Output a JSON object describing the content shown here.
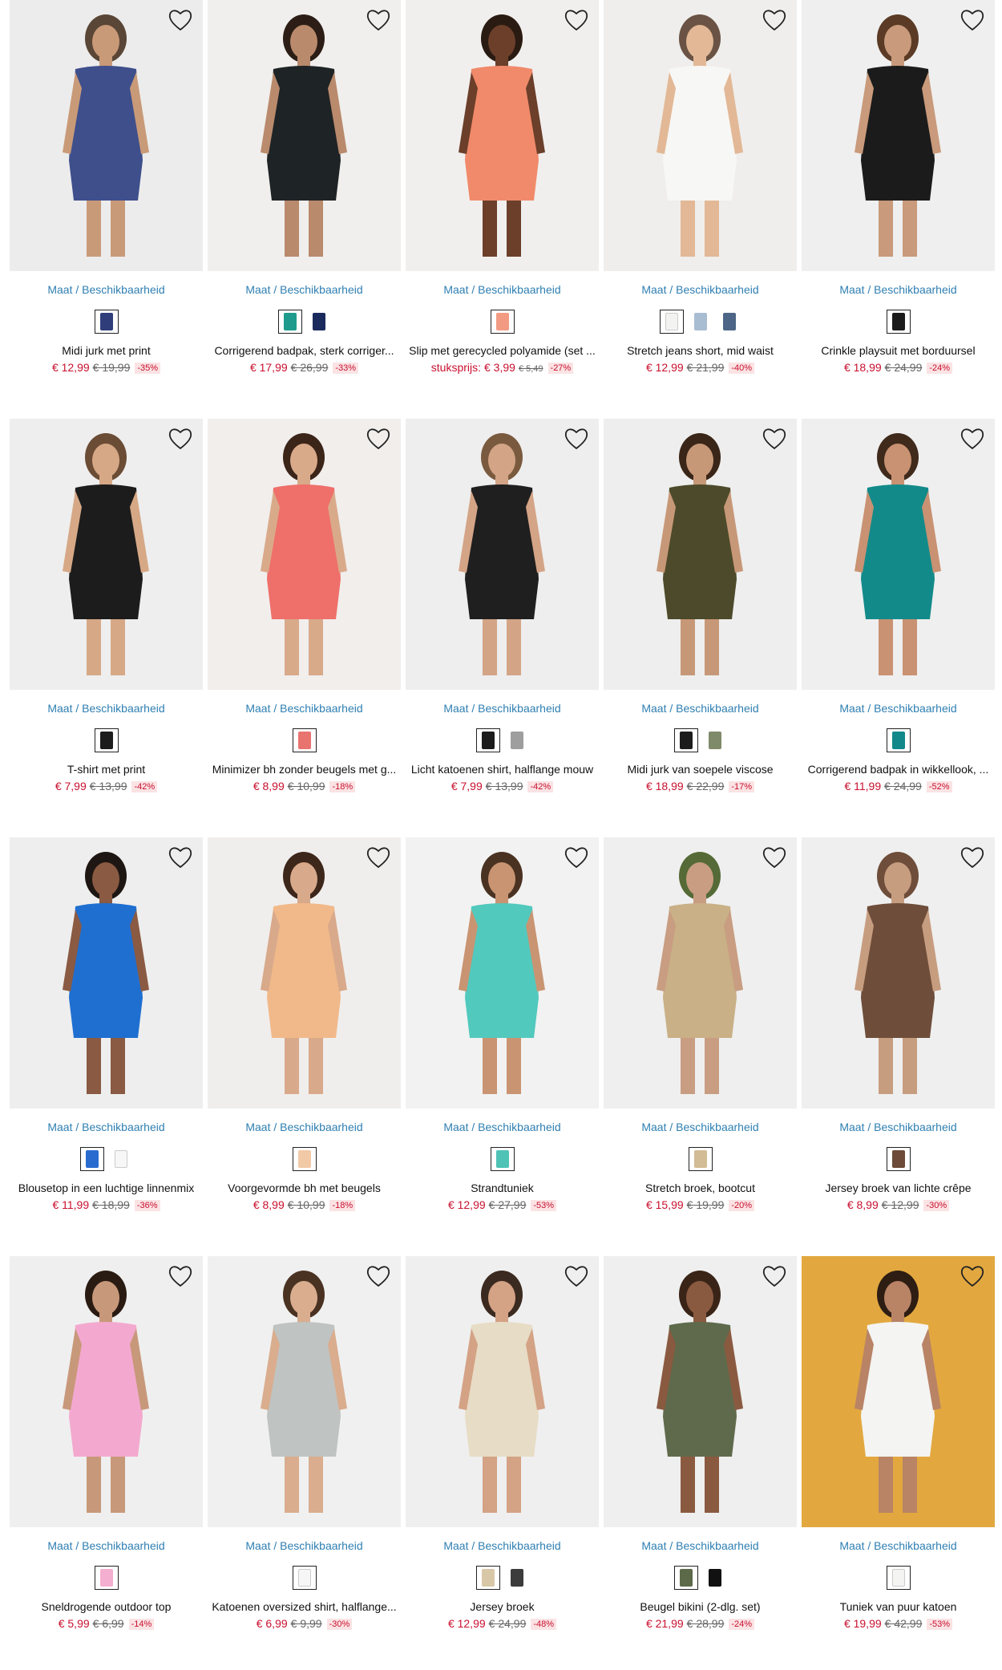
{
  "size_link_label": "Maat / Beschikbaarheid",
  "colors": {
    "accent_link": "#2f7fb2",
    "price_red": "#c8102e",
    "discount_bg": "#fbe3e4"
  },
  "products": [
    {
      "title": "Midi jurk met print",
      "price": "€ 12,99",
      "old": "€ 19,99",
      "discount": "-35%",
      "bg": "#ececec",
      "garment": "#3e4f8c",
      "skin": "#c99a78",
      "hair": "#5a4636",
      "swatches": [
        "#2f3e7a"
      ]
    },
    {
      "title": "Corrigerend badpak, sterk corriger...",
      "price": "€ 17,99",
      "old": "€ 26,99",
      "discount": "-33%",
      "bg": "#f0efed",
      "garment": "#1e2326",
      "skin": "#b98a6c",
      "hair": "#2c1e16",
      "swatches": [
        "#1e9b8c",
        "#1b2a5c"
      ]
    },
    {
      "title": "Slip met gerecycled polyamide (set ...",
      "price_prefix": "stuksprijs:",
      "price": "€ 3,99",
      "old": "€ 5,49",
      "old_small": true,
      "discount": "-27%",
      "bg": "#f1efee",
      "garment": "#f08a6a",
      "skin": "#6b3f2a",
      "hair": "#2a1b12",
      "swatches": [
        "#f29b82"
      ]
    },
    {
      "title": "Stretch jeans short, mid waist",
      "price": "€ 12,99",
      "old": "€ 21,99",
      "discount": "-40%",
      "bg": "#efeeec",
      "garment": "#f7f7f5",
      "skin": "#e2b896",
      "hair": "#6a5344",
      "swatches": [
        "#f3f3f1",
        "#a9bdd2",
        "#4d6687"
      ]
    },
    {
      "title": "Crinkle playsuit met borduursel",
      "price": "€ 18,99",
      "old": "€ 24,99",
      "discount": "-24%",
      "bg": "#efefef",
      "garment": "#1b1b1b",
      "skin": "#c99a7b",
      "hair": "#5b3b26",
      "swatches": [
        "#1b1b1b"
      ]
    },
    {
      "title": "T-shirt met print",
      "price": "€ 7,99",
      "old": "€ 13,99",
      "discount": "-42%",
      "bg": "#eeeeee",
      "garment": "#1c1c1c",
      "skin": "#d6a886",
      "hair": "#6b4c35",
      "swatches": [
        "#1c1c1c"
      ]
    },
    {
      "title": "Minimizer bh zonder beugels met g...",
      "price": "€ 8,99",
      "old": "€ 10,99",
      "discount": "-18%",
      "bg": "#f1eeec",
      "garment": "#ef6f6a",
      "skin": "#d9aa8a",
      "hair": "#3b2418",
      "swatches": [
        "#e9736f"
      ]
    },
    {
      "title": "Licht katoenen shirt, halflange mouw",
      "price": "€ 7,99",
      "old": "€ 13,99",
      "discount": "-42%",
      "bg": "#eeeeee",
      "garment": "#1f1f1f",
      "skin": "#d4a486",
      "hair": "#7a5a3f",
      "swatches": [
        "#1c1c1c",
        "#9e9e9e"
      ]
    },
    {
      "title": "Midi jurk van soepele viscose",
      "price": "€ 18,99",
      "old": "€ 22,99",
      "discount": "-17%",
      "bg": "#eeeeee",
      "garment": "#4c4a2a",
      "skin": "#c79878",
      "hair": "#3a2618",
      "swatches": [
        "#1c1c1c",
        "#7f8a6a"
      ]
    },
    {
      "title": "Corrigerend badpak in wikkellook, ...",
      "price": "€ 11,99",
      "old": "€ 24,99",
      "discount": "-52%",
      "bg": "#efefef",
      "garment": "#138a8a",
      "skin": "#c99272",
      "hair": "#3f2a1c",
      "swatches": [
        "#12888a"
      ]
    },
    {
      "title": "Blousetop in een luchtige linnenmix",
      "price": "€ 11,99",
      "old": "€ 18,99",
      "discount": "-36%",
      "bg": "#eeeeee",
      "garment": "#1f6fd1",
      "skin": "#8a5a42",
      "hair": "#1e1612",
      "swatches": [
        "#2a6bd0",
        "#f7f7f7"
      ]
    },
    {
      "title": "Voorgevormde bh met beugels",
      "price": "€ 8,99",
      "old": "€ 10,99",
      "discount": "-18%",
      "bg": "#f0eeed",
      "garment": "#f1b98a",
      "skin": "#d8a98a",
      "hair": "#3d261a",
      "swatches": [
        "#f2c9a6"
      ]
    },
    {
      "title": "Strandtuniek",
      "price": "€ 12,99",
      "old": "€ 27,99",
      "discount": "-53%",
      "bg": "#f2f2f2",
      "garment": "#52c9bd",
      "skin": "#c99472",
      "hair": "#4a3222",
      "swatches": [
        "#4fc3b6"
      ]
    },
    {
      "title": "Stretch broek, bootcut",
      "price": "€ 15,99",
      "old": "€ 19,99",
      "discount": "-20%",
      "bg": "#efefef",
      "garment": "#c9b086",
      "skin": "#c89d82",
      "hair": "#556a36",
      "swatches": [
        "#d2bc95"
      ]
    },
    {
      "title": "Jersey broek van lichte crêpe",
      "price": "€ 8,99",
      "old": "€ 12,99",
      "discount": "-30%",
      "bg": "#efefef",
      "garment": "#6e4d3a",
      "skin": "#c79d80",
      "hair": "#6e4d3a",
      "swatches": [
        "#6d4b38"
      ]
    },
    {
      "title": "Sneldrogende outdoor top",
      "price": "€ 5,99",
      "old": "€ 6,99",
      "discount": "-14%",
      "bg": "#efefef",
      "garment": "#f3a9cf",
      "skin": "#c8987a",
      "hair": "#2a1b12",
      "swatches": [
        "#f4aecf"
      ]
    },
    {
      "title": "Katoenen oversized shirt, halflange...",
      "price": "€ 6,99",
      "old": "€ 9,99",
      "discount": "-30%",
      "bg": "#f0f0f0",
      "garment": "#bfc3c2",
      "skin": "#d9ad8e",
      "hair": "#4a3222",
      "swatches": [
        "#f6f6f6"
      ]
    },
    {
      "title": "Jersey broek",
      "price": "€ 12,99",
      "old": "€ 24,99",
      "discount": "-48%",
      "bg": "#efefef",
      "garment": "#e7dcc5",
      "skin": "#d4a285",
      "hair": "#3b2a1f",
      "swatches": [
        "#d8c8a7",
        "#3c3c3c"
      ]
    },
    {
      "title": "Beugel bikini (2-dlg. set)",
      "price": "€ 21,99",
      "old": "€ 28,99",
      "discount": "-24%",
      "bg": "#efefef",
      "garment": "#5f6a4c",
      "skin": "#8a5a40",
      "hair": "#3a2418",
      "swatches": [
        "#5c6a4a",
        "#111111"
      ]
    },
    {
      "title": "Tuniek van puur katoen",
      "price": "€ 19,99",
      "old": "€ 42,99",
      "discount": "-53%",
      "bg": "#e2a83f",
      "garment": "#f4f4f2",
      "skin": "#b98366",
      "hair": "#2e1d13",
      "swatches": [
        "#f4f4f2"
      ]
    }
  ]
}
